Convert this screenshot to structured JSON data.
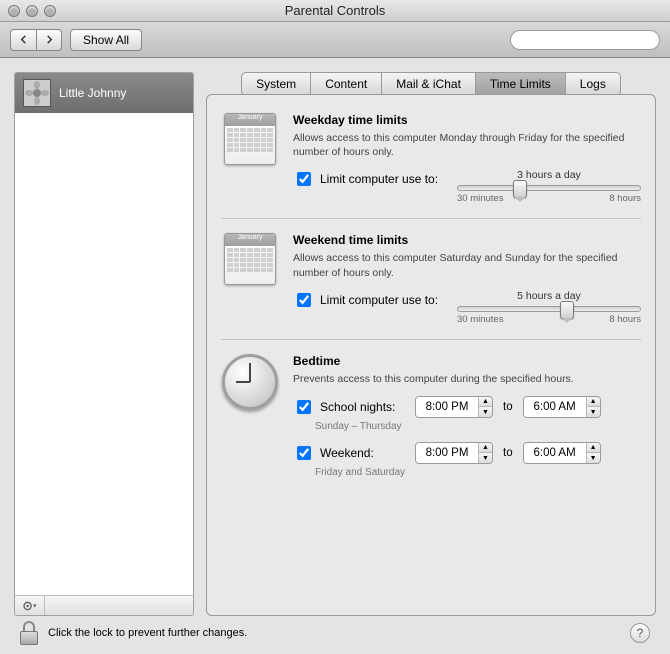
{
  "window": {
    "title": "Parental Controls"
  },
  "toolbar": {
    "show_all": "Show All",
    "search_placeholder": ""
  },
  "sidebar": {
    "account_name": "Little Johnny"
  },
  "tabs": [
    "System",
    "Content",
    "Mail & iChat",
    "Time Limits",
    "Logs"
  ],
  "active_tab_index": 3,
  "sections": {
    "weekday": {
      "title": "Weekday time limits",
      "desc": "Allows access to this computer Monday through Friday for the specified number of hours only.",
      "limit_label": "Limit computer use to:",
      "value_label": "3 hours a day",
      "min_label": "30 minutes",
      "max_label": "8 hours",
      "thumb_pct": 34
    },
    "weekend": {
      "title": "Weekend time limits",
      "desc": "Allows access to this computer Saturday and Sunday for the specified number of hours only.",
      "limit_label": "Limit computer use to:",
      "value_label": "5 hours a day",
      "min_label": "30 minutes",
      "max_label": "8 hours",
      "thumb_pct": 60
    },
    "bedtime": {
      "title": "Bedtime",
      "desc": "Prevents access to this computer during the specified hours.",
      "school_label": "School nights:",
      "school_sub": "Sunday – Thursday",
      "school_from": "8:00 PM",
      "school_to_word": "to",
      "school_to": "6:00 AM",
      "weekend_label": "Weekend:",
      "weekend_sub": "Friday and Saturday",
      "weekend_from": "8:00 PM",
      "weekend_to_word": "to",
      "weekend_to": "6:00 AM"
    },
    "cal_month": "January"
  },
  "footer": {
    "lock_text": "Click the lock to prevent further changes.",
    "help": "?"
  }
}
